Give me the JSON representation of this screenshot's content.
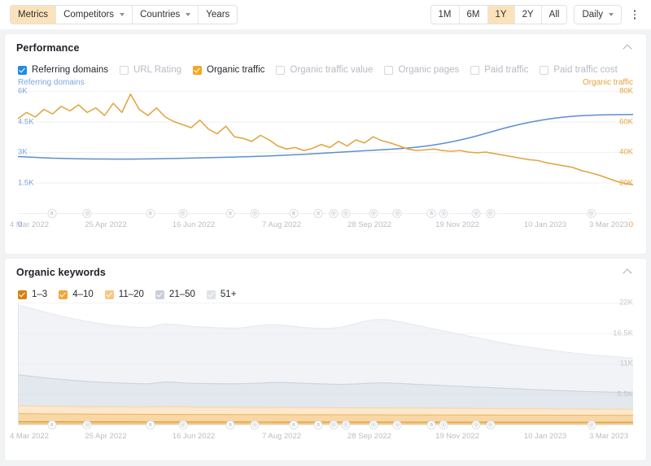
{
  "toolbar": {
    "nav": [
      {
        "label": "Metrics",
        "active": true,
        "caret": false
      },
      {
        "label": "Competitors",
        "active": false,
        "caret": true
      },
      {
        "label": "Countries",
        "active": false,
        "caret": true
      },
      {
        "label": "Years",
        "active": false,
        "caret": false
      }
    ],
    "ranges": [
      {
        "label": "1M",
        "active": false
      },
      {
        "label": "6M",
        "active": false
      },
      {
        "label": "1Y",
        "active": true
      },
      {
        "label": "2Y",
        "active": false
      },
      {
        "label": "All",
        "active": false
      }
    ],
    "granularity": {
      "label": "Daily",
      "icon": "chevron-down-icon"
    },
    "more_menu_icon": "kebab-menu-icon"
  },
  "performance": {
    "title": "Performance",
    "collapse_icon": "chevron-up-icon",
    "metrics": [
      {
        "label": "Referring domains",
        "checked": true,
        "color": "#1f8ceb"
      },
      {
        "label": "URL Rating",
        "checked": false,
        "color": "#d3d7dd"
      },
      {
        "label": "Organic traffic",
        "checked": true,
        "color": "#f5a623"
      },
      {
        "label": "Organic traffic value",
        "checked": false,
        "color": "#d3d7dd"
      },
      {
        "label": "Organic pages",
        "checked": false,
        "color": "#d3d7dd"
      },
      {
        "label": "Paid traffic",
        "checked": false,
        "color": "#d3d7dd"
      },
      {
        "label": "Paid traffic cost",
        "checked": false,
        "color": "#d3d7dd"
      }
    ],
    "left_axis_title": "Referring domains",
    "right_axis_title": "Organic traffic"
  },
  "keywords": {
    "title": "Organic keywords",
    "collapse_icon": "chevron-up-icon",
    "buckets": [
      {
        "label": "1–3",
        "checked": true,
        "color": "#d6820e"
      },
      {
        "label": "4–10",
        "checked": true,
        "color": "#f0a73a"
      },
      {
        "label": "11–20",
        "checked": true,
        "color": "#f7c886"
      },
      {
        "label": "21–50",
        "checked": true,
        "color": "#c8cfdb"
      },
      {
        "label": "51+",
        "checked": true,
        "color": "#dfe3e8"
      }
    ]
  },
  "chart_data": [
    {
      "type": "line",
      "title": "Performance",
      "xlabel": "",
      "ylabel": "Referring domains",
      "y2label": "Organic traffic",
      "ylim": [
        0,
        6000
      ],
      "y2lim": [
        0,
        80000
      ],
      "yticks": [
        "0",
        "1.5K",
        "3K",
        "4.5K",
        "6K"
      ],
      "y2ticks": [
        "0",
        "20K",
        "40K",
        "60K",
        "80K"
      ],
      "grid": true,
      "legend_position": "top",
      "xticks": [
        "4 Mar 2022",
        "25 Apr 2022",
        "16 Jun 2022",
        "7 Aug 2022",
        "28 Sep 2022",
        "19 Nov 2022",
        "10 Jan 2023",
        "3 Mar 2023"
      ],
      "series": [
        {
          "name": "Referring domains",
          "color": "#5b8fd0",
          "axis": "left",
          "values": [
            2780,
            2760,
            2740,
            2720,
            2700,
            2690,
            2680,
            2670,
            2665,
            2660,
            2658,
            2655,
            2655,
            2657,
            2660,
            2665,
            2670,
            2678,
            2685,
            2695,
            2705,
            2715,
            2725,
            2735,
            2745,
            2755,
            2768,
            2780,
            2795,
            2812,
            2830,
            2850,
            2870,
            2890,
            2915,
            2940,
            2965,
            2990,
            3015,
            3040,
            3065,
            3090,
            3115,
            3140,
            3170,
            3200,
            3240,
            3290,
            3350,
            3420,
            3500,
            3590,
            3690,
            3800,
            3920,
            4040,
            4160,
            4270,
            4370,
            4460,
            4540,
            4610,
            4670,
            4720,
            4760,
            4790,
            4810,
            4825,
            4835,
            4840,
            4845,
            4848
          ]
        },
        {
          "name": "Organic traffic",
          "color": "#e0a33c",
          "axis": "right",
          "values": [
            62000,
            66000,
            63000,
            68000,
            65000,
            70000,
            67000,
            71000,
            66000,
            69000,
            64000,
            72000,
            66000,
            78000,
            68000,
            64000,
            69000,
            63000,
            60000,
            58000,
            56000,
            61000,
            55000,
            52000,
            57000,
            50000,
            49000,
            47000,
            51000,
            48000,
            44000,
            42000,
            43000,
            41000,
            42500,
            45000,
            43000,
            47000,
            44000,
            48000,
            46000,
            50000,
            47500,
            46000,
            44000,
            42000,
            41000,
            41500,
            42000,
            41000,
            40500,
            41000,
            40000,
            39500,
            40000,
            39000,
            38000,
            37000,
            36000,
            35000,
            34500,
            33000,
            32000,
            31000,
            30000,
            28000,
            26500,
            25000,
            23000,
            21000,
            19500,
            18500
          ]
        }
      ]
    },
    {
      "type": "area",
      "title": "Organic keywords",
      "xlabel": "",
      "ylabel": "",
      "ylim": [
        0,
        22000
      ],
      "yticks": [
        "5.5K",
        "11K",
        "16.5K",
        "22K"
      ],
      "grid": true,
      "stacked": true,
      "legend_position": "top",
      "xticks": [
        "4 Mar 2022",
        "25 Apr 2022",
        "16 Jun 2022",
        "7 Aug 2022",
        "28 Sep 2022",
        "19 Nov 2022",
        "10 Jan 2023",
        "3 Mar 2023"
      ],
      "series": [
        {
          "name": "1–3",
          "color": "#e09a2c",
          "values": [
            520,
            515,
            510,
            505,
            500,
            498,
            495,
            492,
            490,
            488,
            486,
            484,
            482,
            480,
            478,
            476,
            474,
            472,
            470,
            468,
            466,
            465,
            464,
            463,
            462,
            461,
            460,
            459,
            458,
            457,
            456,
            455,
            454,
            453,
            452,
            451,
            450,
            449,
            448,
            447,
            446,
            445,
            444,
            443,
            442,
            441,
            440,
            439,
            438,
            437,
            436,
            435,
            434,
            433,
            432,
            431,
            430,
            429,
            428,
            427,
            426,
            425,
            424,
            423,
            422,
            421,
            420,
            419,
            418,
            417,
            416,
            415
          ]
        },
        {
          "name": "4–10",
          "color": "#f2b75c",
          "values": [
            1450,
            1440,
            1430,
            1420,
            1415,
            1410,
            1405,
            1400,
            1395,
            1390,
            1385,
            1380,
            1375,
            1370,
            1365,
            1360,
            1358,
            1355,
            1352,
            1350,
            1348,
            1345,
            1342,
            1340,
            1338,
            1336,
            1334,
            1332,
            1330,
            1328,
            1326,
            1324,
            1322,
            1320,
            1318,
            1316,
            1314,
            1312,
            1310,
            1308,
            1306,
            1304,
            1302,
            1300,
            1298,
            1296,
            1294,
            1292,
            1290,
            1288,
            1286,
            1284,
            1282,
            1280,
            1278,
            1276,
            1274,
            1272,
            1270,
            1268,
            1266,
            1264,
            1262,
            1260,
            1258,
            1256,
            1254,
            1252,
            1250,
            1248,
            1246,
            1244
          ]
        },
        {
          "name": "11–20",
          "color": "#f9d6a2",
          "values": [
            1400,
            1390,
            1380,
            1370,
            1365,
            1360,
            1355,
            1350,
            1345,
            1340,
            1335,
            1330,
            1325,
            1320,
            1318,
            1316,
            1380,
            1400,
            1390,
            1370,
            1350,
            1340,
            1335,
            1330,
            1325,
            1320,
            1315,
            1310,
            1305,
            1300,
            1295,
            1290,
            1285,
            1280,
            1275,
            1270,
            1265,
            1260,
            1255,
            1250,
            1245,
            1240,
            1235,
            1230,
            1225,
            1220,
            1215,
            1210,
            1205,
            1200,
            1195,
            1190,
            1185,
            1180,
            1175,
            1170,
            1165,
            1160,
            1155,
            1150,
            1145,
            1140,
            1135,
            1130,
            1125,
            1120,
            1115,
            1110,
            1105,
            1100,
            1095,
            1090
          ]
        },
        {
          "name": "21–50",
          "color": "#ccd4e0",
          "values": [
            5600,
            5450,
            5300,
            5150,
            5000,
            4880,
            4760,
            4650,
            4550,
            4470,
            4400,
            4340,
            4290,
            4250,
            4220,
            4200,
            4300,
            4420,
            4400,
            4330,
            4280,
            4260,
            4250,
            4240,
            4230,
            4240,
            4280,
            4330,
            4400,
            4480,
            4520,
            4500,
            4450,
            4400,
            4350,
            4300,
            4260,
            4230,
            4250,
            4320,
            4420,
            4500,
            4540,
            4520,
            4460,
            4380,
            4300,
            4230,
            4170,
            4110,
            4050,
            3990,
            3930,
            3870,
            3810,
            3750,
            3690,
            3630,
            3570,
            3510,
            3450,
            3390,
            3330,
            3280,
            3230,
            3190,
            3150,
            3120,
            3090,
            3060,
            3040,
            3020
          ]
        },
        {
          "name": "51+",
          "color": "#e6eaef",
          "values": [
            12600,
            12400,
            12150,
            11900,
            11650,
            11400,
            11200,
            11000,
            10800,
            10650,
            10500,
            10380,
            10280,
            10200,
            10150,
            10120,
            10400,
            10520,
            10450,
            10350,
            10250,
            10200,
            10150,
            10100,
            10050,
            10000,
            10100,
            10250,
            10400,
            10450,
            10400,
            10280,
            10150,
            10050,
            10000,
            9980,
            10050,
            10250,
            10550,
            10900,
            11200,
            11400,
            11450,
            11350,
            11150,
            10900,
            10650,
            10400,
            10150,
            9900,
            9650,
            9400,
            9150,
            8900,
            8650,
            8400,
            8150,
            7950,
            7750,
            7600,
            7450,
            7300,
            7150,
            7000,
            6880,
            6760,
            6650,
            6550,
            6460,
            6380,
            6300,
            6240
          ]
        }
      ]
    }
  ]
}
